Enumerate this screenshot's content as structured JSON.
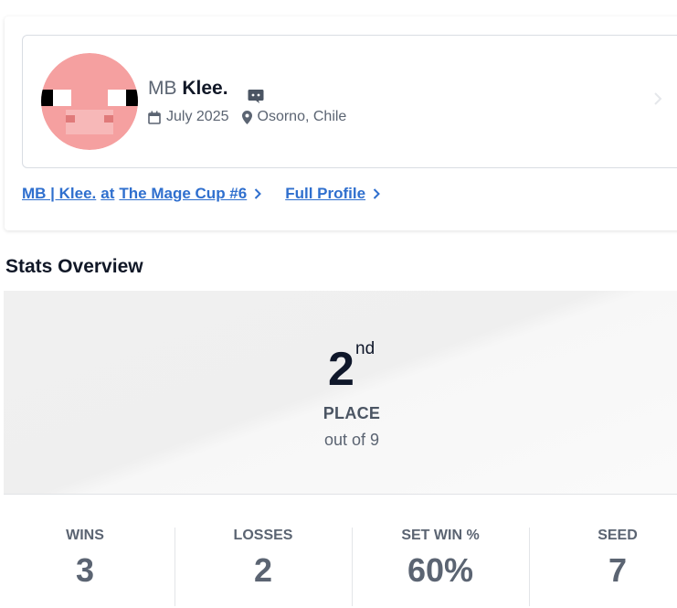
{
  "profile": {
    "team_tag": "MB",
    "player_name": "Klee.",
    "joined": "July 2025",
    "location": "Osorno, Chile",
    "avatar_colors": {
      "skin": "#f5a0a0",
      "snout": "#f7b8b8",
      "nostril": "#e07a7a",
      "eye_white": "#ffffff",
      "eye_black": "#000000"
    }
  },
  "links": {
    "event_entry_prefix": "MB | Klee.",
    "event_entry_at": "at",
    "event_entry_event": "The Mage Cup #6",
    "full_profile": "Full Profile"
  },
  "stats_section": {
    "title": "Stats Overview",
    "placement_number": "2",
    "placement_suffix": "nd",
    "placement_label": "PLACE",
    "out_of": "out of 9"
  },
  "stats": [
    {
      "label": "WINS",
      "value": "3"
    },
    {
      "label": "LOSSES",
      "value": "2"
    },
    {
      "label": "SET WIN %",
      "value": "60%"
    },
    {
      "label": "SEED",
      "value": "7"
    }
  ],
  "colors": {
    "link": "#2f6fce",
    "muted": "#5b6472"
  }
}
